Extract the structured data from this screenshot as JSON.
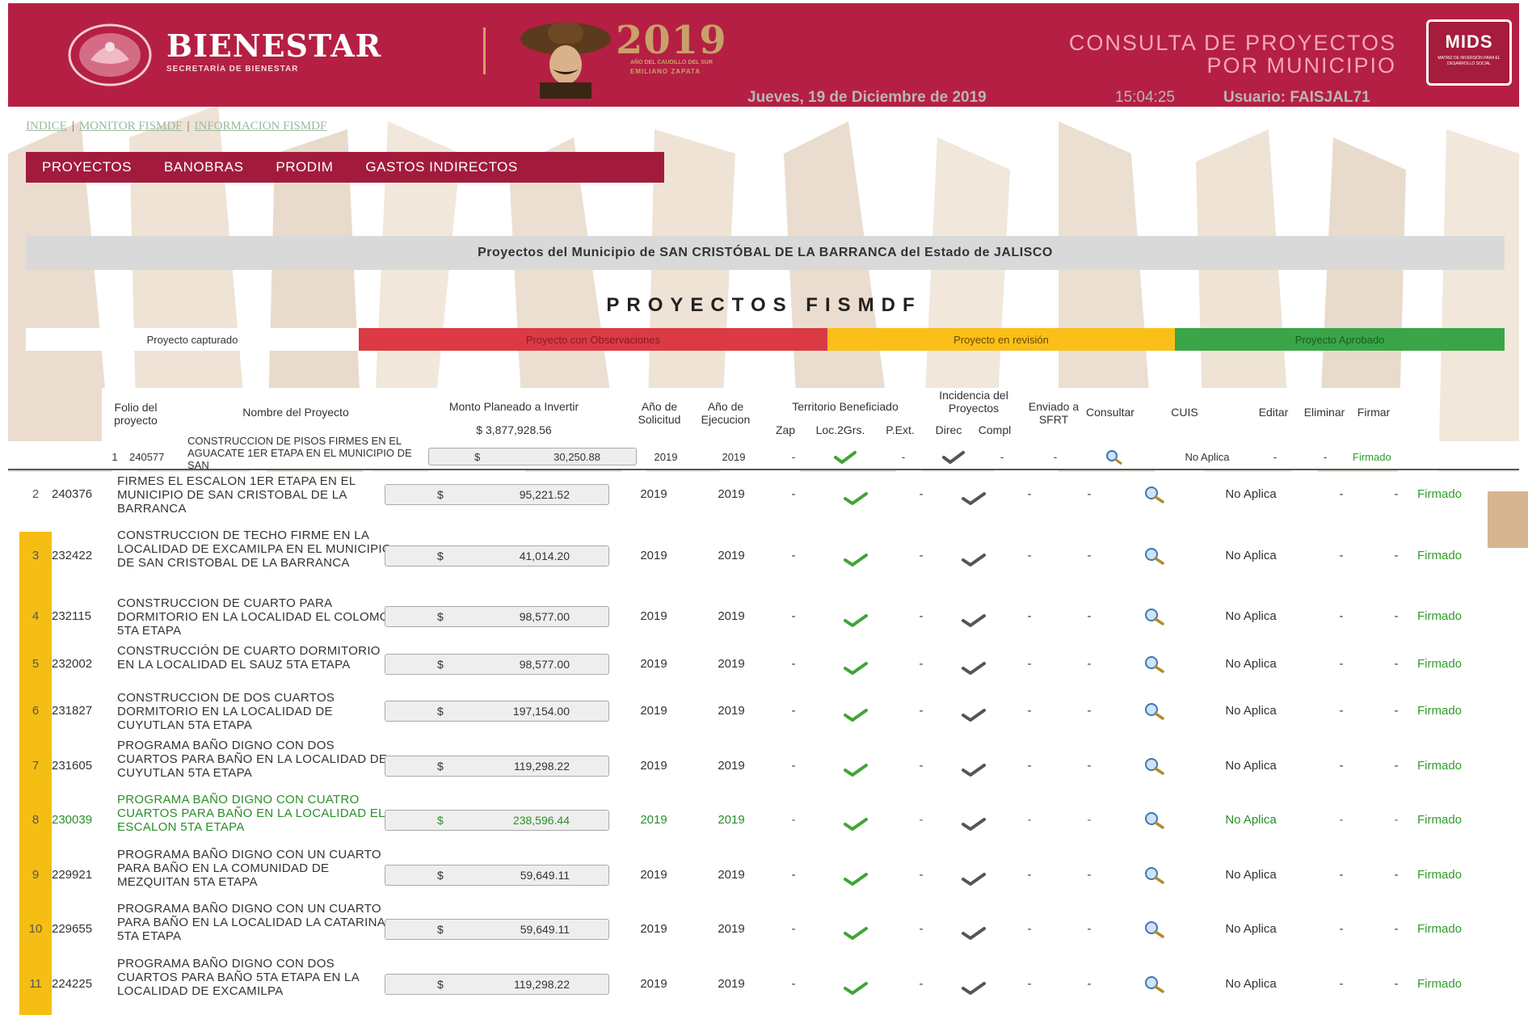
{
  "header": {
    "brand": "BIENESTAR",
    "brand_sub": "SECRETARÍA DE BIENESTAR",
    "year": "2019",
    "year_sub1": "AÑO DEL CAUDILLO DEL SUR",
    "year_sub2": "EMILIANO ZAPATA",
    "title_line1": "CONSULTA DE PROYECTOS",
    "title_line2": "POR MUNICIPIO",
    "mids_title": "MIDS",
    "mids_sub": "MATRIZ DE INVERSIÓN PARA EL DESARROLLO SOCIAL",
    "date": "Jueves, 19 de Diciembre de 2019",
    "time": "15:04:25",
    "user": "Usuario: FAISJAL71"
  },
  "links": [
    "INDICE",
    "MONITOR FISMDF",
    "INFORMACION FISMDF"
  ],
  "nav": [
    "PROYECTOS",
    "BANOBRAS",
    "PRODIM",
    "GASTOS INDIRECTOS"
  ],
  "banner": "Proyectos del Municipio de SAN CRISTÓBAL DE LA BARRANCA del Estado de JALISCO",
  "section_title": "PROYECTOS FISMDF",
  "legend": [
    {
      "label": "Proyecto capturado",
      "bg": "#ffffff",
      "fg": "#333333"
    },
    {
      "label": "Proyecto con Observaciones",
      "bg": "#db3a44",
      "fg": "#8b1a22"
    },
    {
      "label": "Proyecto en revisión",
      "bg": "#fbbf1a",
      "fg": "#6b4a00"
    },
    {
      "label": "Proyecto Aprobado",
      "bg": "#3aa548",
      "fg": "#155e1e"
    }
  ],
  "table_header": {
    "folio": "Folio del proyecto",
    "nombre": "Nombre del Proyecto",
    "monto": "Monto Planeado a Invertir",
    "total": "$ 3,877,928.56",
    "solicitud": "Año de Solicitud",
    "ejecucion": "Año de Ejecucion",
    "territorio": "Territorio Beneficiado",
    "zap": "Zap",
    "loc": "Loc.2Grs.",
    "pext": "P.Ext.",
    "incidencia": "Incidencia del Proyectos",
    "direc": "Direc",
    "compl": "Compl",
    "enviado": "Enviado a SFRT",
    "consultar": "Consultar",
    "cuis": "CUIS",
    "editar": "Editar",
    "eliminar": "Eliminar",
    "firmar": "Firmar"
  },
  "row1": {
    "num": "1",
    "folio": "240577",
    "name": "CONSTRUCCION DE PISOS FIRMES EN EL AGUACATE 1ER ETAPA EN EL MUNICIPIO DE SAN",
    "currency": "$",
    "amount": "30,250.88",
    "solicitud": "2019",
    "ejecucion": "2019",
    "zap": "-",
    "pext": "-",
    "compl": "-",
    "enviado": "-",
    "cuis": "No Aplica",
    "editar": "-",
    "eliminar": "-",
    "firmar": "Firmado"
  },
  "rows": [
    {
      "num": "2",
      "folio": "240376",
      "name": "FIRMES EL ESCALON 1ER ETAPA EN EL MUNICIPIO DE SAN CRISTOBAL DE LA BARRANCA",
      "currency": "$",
      "amount": "95,221.52",
      "solicitud": "2019",
      "ejecucion": "2019",
      "zap": "-",
      "pext": "-",
      "compl": "-",
      "enviado": "-",
      "cuis": "No Aplica",
      "editar": "-",
      "eliminar": "-",
      "firmar": "Firmado"
    },
    {
      "num": "3",
      "folio": "232422",
      "name": "CONSTRUCCION DE TECHO FIRME EN LA LOCALIDAD DE EXCAMILPA EN EL MUNICIPIO DE SAN CRISTOBAL DE LA BARRANCA",
      "currency": "$",
      "amount": "41,014.20",
      "solicitud": "2019",
      "ejecucion": "2019",
      "zap": "-",
      "pext": "-",
      "compl": "-",
      "enviado": "-",
      "cuis": "No Aplica",
      "editar": "-",
      "eliminar": "-",
      "firmar": "Firmado"
    },
    {
      "num": "4",
      "folio": "232115",
      "name": "CONSTRUCCION DE CUARTO PARA DORMITORIO EN LA LOCALIDAD EL COLOMO 5TA ETAPA",
      "currency": "$",
      "amount": "98,577.00",
      "solicitud": "2019",
      "ejecucion": "2019",
      "zap": "-",
      "pext": "-",
      "compl": "-",
      "enviado": "-",
      "cuis": "No Aplica",
      "editar": "-",
      "eliminar": "-",
      "firmar": "Firmado"
    },
    {
      "num": "5",
      "folio": "232002",
      "name": "CONSTRUCCIÓN DE CUARTO DORMITORIO EN LA LOCALIDAD EL SAUZ 5TA ETAPA",
      "currency": "$",
      "amount": "98,577.00",
      "solicitud": "2019",
      "ejecucion": "2019",
      "zap": "-",
      "pext": "-",
      "compl": "-",
      "enviado": "-",
      "cuis": "No Aplica",
      "editar": "-",
      "eliminar": "-",
      "firmar": "Firmado"
    },
    {
      "num": "6",
      "folio": "231827",
      "name": "CONSTRUCCION DE DOS CUARTOS DORMITORIO EN LA LOCALIDAD DE CUYUTLAN 5TA ETAPA",
      "currency": "$",
      "amount": "197,154.00",
      "solicitud": "2019",
      "ejecucion": "2019",
      "zap": "-",
      "pext": "-",
      "compl": "-",
      "enviado": "-",
      "cuis": "No Aplica",
      "editar": "-",
      "eliminar": "-",
      "firmar": "Firmado"
    },
    {
      "num": "7",
      "folio": "231605",
      "name": "PROGRAMA BAÑO DIGNO CON DOS CUARTOS PARA BAÑO EN LA LOCALIDAD DE CUYUTLAN 5TA ETAPA",
      "currency": "$",
      "amount": "119,298.22",
      "solicitud": "2019",
      "ejecucion": "2019",
      "zap": "-",
      "pext": "-",
      "compl": "-",
      "enviado": "-",
      "cuis": "No Aplica",
      "editar": "-",
      "eliminar": "-",
      "firmar": "Firmado"
    },
    {
      "num": "8",
      "folio": "230039",
      "name": "PROGRAMA BAÑO DIGNO CON CUATRO CUARTOS PARA BAÑO EN LA LOCALIDAD EL ESCALON 5TA ETAPA",
      "currency": "$",
      "amount": "238,596.44",
      "solicitud": "2019",
      "ejecucion": "2019",
      "zap": "-",
      "pext": "-",
      "compl": "-",
      "enviado": "-",
      "cuis": "No Aplica",
      "editar": "-",
      "eliminar": "-",
      "firmar": "Firmado",
      "green": true
    },
    {
      "num": "9",
      "folio": "229921",
      "name": "PROGRAMA BAÑO DIGNO CON UN CUARTO PARA BAÑO EN LA COMUNIDAD DE MEZQUITAN 5TA ETAPA",
      "currency": "$",
      "amount": "59,649.11",
      "solicitud": "2019",
      "ejecucion": "2019",
      "zap": "-",
      "pext": "-",
      "compl": "-",
      "enviado": "-",
      "cuis": "No Aplica",
      "editar": "-",
      "eliminar": "-",
      "firmar": "Firmado"
    },
    {
      "num": "10",
      "folio": "229655",
      "name": "PROGRAMA BAÑO DIGNO CON UN CUARTO PARA BAÑO EN LA LOCALIDAD LA CATARINA 5TA ETAPA",
      "currency": "$",
      "amount": "59,649.11",
      "solicitud": "2019",
      "ejecucion": "2019",
      "zap": "-",
      "pext": "-",
      "compl": "-",
      "enviado": "-",
      "cuis": "No Aplica",
      "editar": "-",
      "eliminar": "-",
      "firmar": "Firmado"
    },
    {
      "num": "11",
      "folio": "224225",
      "name": "PROGRAMA BAÑO DIGNO CON DOS CUARTOS PARA BAÑO 5TA ETAPA EN LA LOCALIDAD DE EXCAMILPA",
      "currency": "$",
      "amount": "119,298.22",
      "solicitud": "2019",
      "ejecucion": "2019",
      "zap": "-",
      "pext": "-",
      "compl": "-",
      "enviado": "-",
      "cuis": "No Aplica",
      "editar": "-",
      "eliminar": "-",
      "firmar": "Firmado"
    }
  ]
}
